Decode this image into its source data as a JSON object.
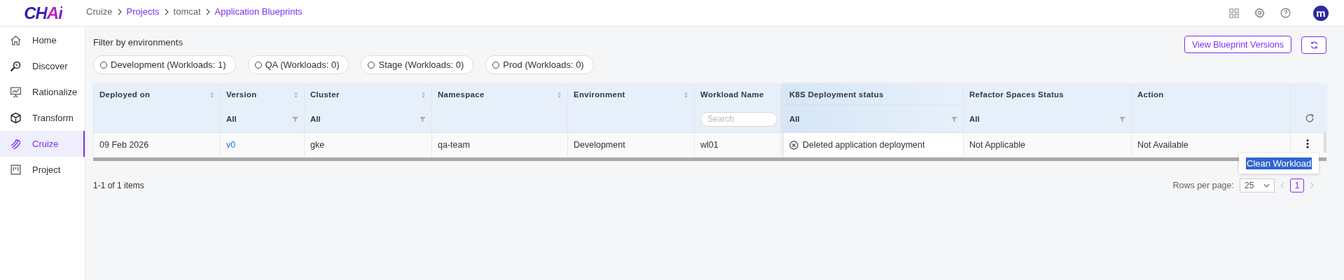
{
  "logo": "CHAi",
  "breadcrumb": [
    {
      "label": "Cruize",
      "link": false
    },
    {
      "label": "Projects",
      "link": true
    },
    {
      "label": "tomcat",
      "link": false
    },
    {
      "label": "Application Blueprints",
      "link": true
    }
  ],
  "avatar": "m",
  "sidebar": {
    "items": [
      {
        "label": "Home",
        "selected": false
      },
      {
        "label": "Discover",
        "selected": false
      },
      {
        "label": "Rationalize",
        "selected": false
      },
      {
        "label": "Transform",
        "selected": false
      },
      {
        "label": "Cruize",
        "selected": true
      },
      {
        "label": "Project",
        "selected": false
      }
    ]
  },
  "filter_label": "Filter by environments",
  "environments": [
    {
      "label": "Development (Workloads: 1)",
      "selected": false
    },
    {
      "label": "QA (Workloads: 0)",
      "selected": false
    },
    {
      "label": "Stage (Workloads: 0)",
      "selected": false
    },
    {
      "label": "Prod (Workloads: 0)",
      "selected": false
    }
  ],
  "buttons": [
    "View Blueprint Versions"
  ],
  "table": {
    "columns": [
      {
        "label": "Deployed on",
        "sortable": true,
        "kind": "plain"
      },
      {
        "label": "Version",
        "sortable": true,
        "kind": "select",
        "value": "All"
      },
      {
        "label": "Cluster",
        "sortable": true,
        "kind": "select",
        "value": "All"
      },
      {
        "label": "Namespace",
        "sortable": true,
        "kind": "plain"
      },
      {
        "label": "Environment",
        "sortable": true,
        "kind": "plain"
      },
      {
        "label": "Workload Name",
        "sortable": false,
        "kind": "search",
        "placeholder": "Search"
      },
      {
        "label": "K8S Deployment status",
        "sortable": false,
        "kind": "select",
        "value": "All"
      },
      {
        "label": "Refactor Spaces Status",
        "sortable": false,
        "kind": "select",
        "value": "All"
      },
      {
        "label": "Action",
        "sortable": false,
        "kind": "plain"
      }
    ],
    "rows": [
      {
        "cells": [
          "09 Feb 2026",
          "v0",
          "gke",
          "qa-team",
          "Development",
          "wl01",
          "Deleted application deployment",
          "Not Applicable",
          "Not Available"
        ]
      }
    ]
  },
  "menu": {
    "items": [
      {
        "label": "Clean Workload",
        "selected": true
      }
    ]
  },
  "footer": {
    "count": "1-1 of 1 items",
    "rows_per_page_label": "Rows per page:",
    "rows_per_page": "25",
    "page": "1"
  }
}
